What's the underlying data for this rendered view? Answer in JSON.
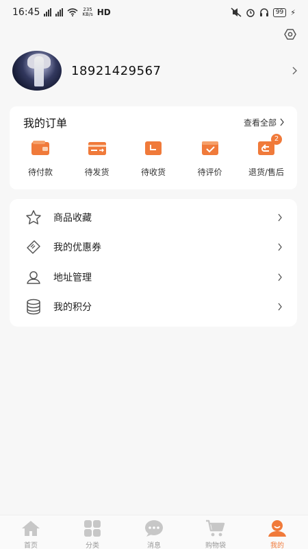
{
  "status_bar": {
    "time": "16:45",
    "net_speed_value": "235",
    "net_speed_unit": "KB/s",
    "hd": "HD",
    "battery": "99"
  },
  "profile": {
    "phone": "18921429567"
  },
  "orders": {
    "title": "我的订单",
    "view_all": "查看全部",
    "items": [
      {
        "label": "待付款",
        "icon": "wallet-icon"
      },
      {
        "label": "待发货",
        "icon": "card-icon"
      },
      {
        "label": "待收货",
        "icon": "box-clock-icon"
      },
      {
        "label": "待评价",
        "icon": "check-box-icon"
      },
      {
        "label": "退货/售后",
        "icon": "return-icon",
        "badge": "2"
      }
    ]
  },
  "menu": {
    "items": [
      {
        "label": "商品收藏",
        "icon": "star-icon"
      },
      {
        "label": "我的优惠券",
        "icon": "coupon-icon"
      },
      {
        "label": "地址管理",
        "icon": "location-icon"
      },
      {
        "label": "我的积分",
        "icon": "coins-icon"
      }
    ]
  },
  "bottom_nav": {
    "items": [
      {
        "label": "首页",
        "icon": "home-icon"
      },
      {
        "label": "分类",
        "icon": "grid-icon"
      },
      {
        "label": "消息",
        "icon": "message-icon"
      },
      {
        "label": "购物袋",
        "icon": "cart-icon"
      },
      {
        "label": "我的",
        "icon": "profile-icon",
        "active": true
      }
    ]
  },
  "colors": {
    "accent": "#f07a3a",
    "background": "#f7f7f7",
    "card": "#ffffff",
    "inactive_nav": "#c7c7c7"
  }
}
